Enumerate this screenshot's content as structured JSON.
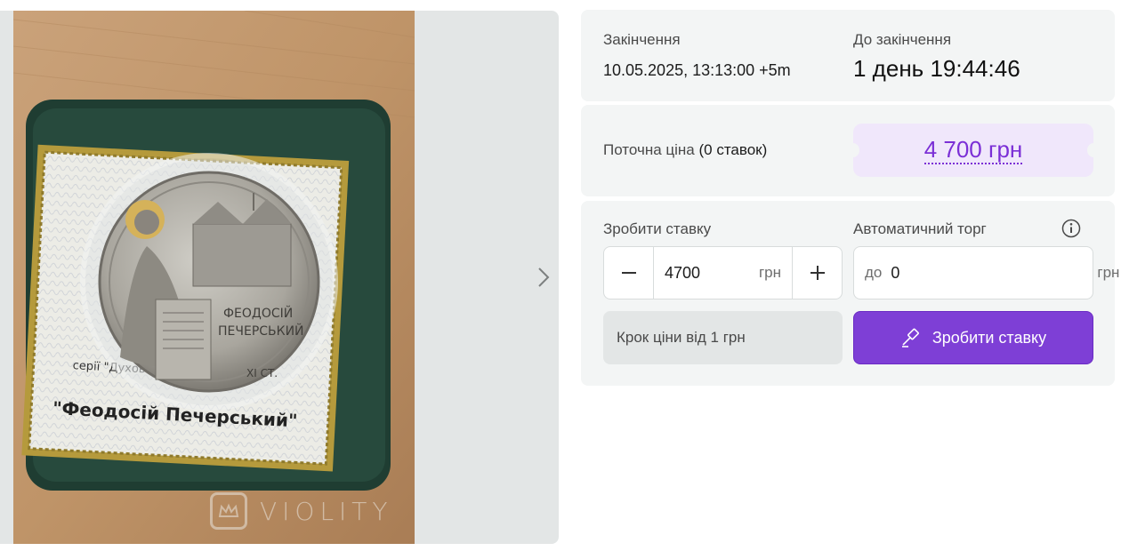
{
  "gallery": {
    "watermark": "VIOLITY",
    "photo": {
      "coin_text_line1": "ФЕОДОСІЙ",
      "coin_text_line2": "ПЕЧЕРСЬКИЙ",
      "coin_century": "XI СТ.",
      "card_series": "серії \"Духовні скарби України\"",
      "card_title": "\"Феодосій Печерський\""
    }
  },
  "auction": {
    "end_label": "Закінчення",
    "end_value": "10.05.2025, 13:13:00 +5m",
    "remaining_label": "До закінчення",
    "remaining_value": "1 день 19:44:46",
    "price_label": "Поточна ціна",
    "bids_count": "(0 ставок)",
    "price_value": "4 700 грн"
  },
  "bid": {
    "label": "Зробити ставку",
    "value": "4700",
    "unit": "грн",
    "auto_label": "Автоматичний торг",
    "auto_prefix": "до",
    "auto_value": "0",
    "auto_unit": "грн",
    "step_text": "Крок ціни від 1 грн",
    "button_label": "Зробити ставку"
  },
  "colors": {
    "accent": "#7e3fd6",
    "price": "#7b2fd6",
    "card_bg": "#f3f5f5"
  },
  "icons": [
    "minus-icon",
    "plus-icon",
    "info-icon",
    "gavel-icon",
    "chevron-right-icon",
    "crown-icon"
  ]
}
